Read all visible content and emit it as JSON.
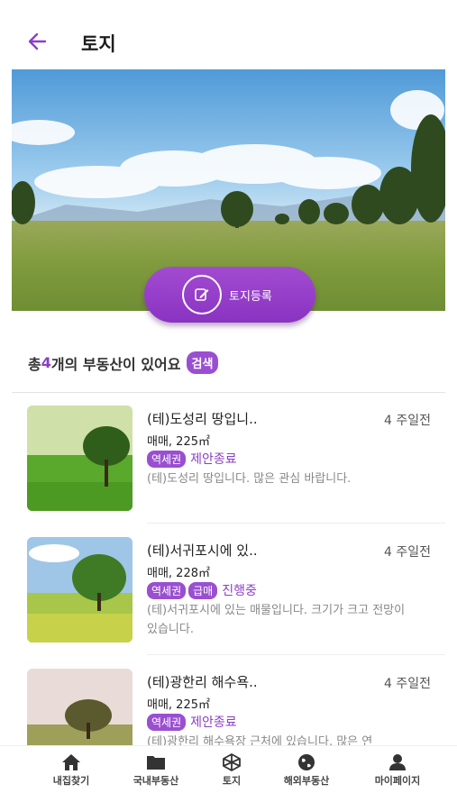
{
  "header": {
    "title": "토지"
  },
  "hero": {
    "register_label": "토지등록"
  },
  "summary": {
    "prefix": "총 ",
    "count": "4",
    "suffix": "개의 부동산이 있어요",
    "search_label": "검색"
  },
  "listings": [
    {
      "title": "(테)도성리 땅입니..",
      "time": "4 주일전",
      "price": "매매, 225㎡",
      "tags": [
        "역세권"
      ],
      "status": "제안종료",
      "desc": "(테)도성리 땅입니다. 많은 관심 바랍니다."
    },
    {
      "title": "(테)서귀포시에 있..",
      "time": "4 주일전",
      "price": "매매, 228㎡",
      "tags": [
        "역세권",
        "급매"
      ],
      "status": "진행중",
      "desc": "(테)서귀포시에 있는 매물입니다. 크기가 크고 전망이 있습니다."
    },
    {
      "title": "(테)광한리 해수욕..",
      "time": "4 주일전",
      "price": "매매, 225㎡",
      "tags": [
        "역세권"
      ],
      "status": "제안종료",
      "desc": "(테)광한리 해수욕장 근처에 있습니다. 많은 연"
    }
  ],
  "tabbar": {
    "items": [
      {
        "label": "내집찾기",
        "icon": "home-icon"
      },
      {
        "label": "국내부동산",
        "icon": "folder-icon"
      },
      {
        "label": "토지",
        "icon": "land-icon"
      },
      {
        "label": "해외부동산",
        "icon": "globe-icon"
      },
      {
        "label": "마이페이지",
        "icon": "user-icon"
      }
    ]
  },
  "colors": {
    "accent": "#8b3fc4",
    "tag": "#9a4fd1"
  }
}
